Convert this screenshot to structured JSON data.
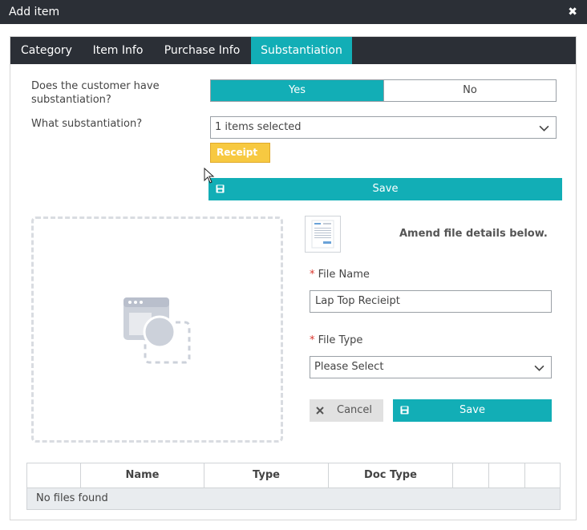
{
  "window": {
    "title": "Add item",
    "close_glyph": "✖"
  },
  "tabs": [
    {
      "label": "Category",
      "active": false
    },
    {
      "label": "Item Info",
      "active": false
    },
    {
      "label": "Purchase Info",
      "active": false
    },
    {
      "label": "Substantiation",
      "active": true
    }
  ],
  "substantiation": {
    "question_has": "Does the customer have substantiation?",
    "yes_label": "Yes",
    "no_label": "No",
    "selected": "Yes",
    "question_what": "What substantiation?",
    "multiselect_value": "1 items selected",
    "selected_tags": [
      "Receipt"
    ],
    "save_label": "Save"
  },
  "file": {
    "amend_text": "Amend file details below.",
    "required_mark": "*",
    "file_name_label": "File Name",
    "file_name_value": "Lap Top Recieipt",
    "file_type_label": "File Type",
    "file_type_value": "Please Select",
    "cancel_label": "Cancel",
    "save_label": "Save"
  },
  "files_table": {
    "columns": [
      "",
      "Name",
      "Type",
      "Doc Type",
      "",
      "",
      ""
    ],
    "empty_text": "No files found"
  },
  "colors": {
    "accent": "#12aeb6",
    "dark": "#2b2f36",
    "tag": "#f7c941",
    "required": "#d9342b"
  }
}
